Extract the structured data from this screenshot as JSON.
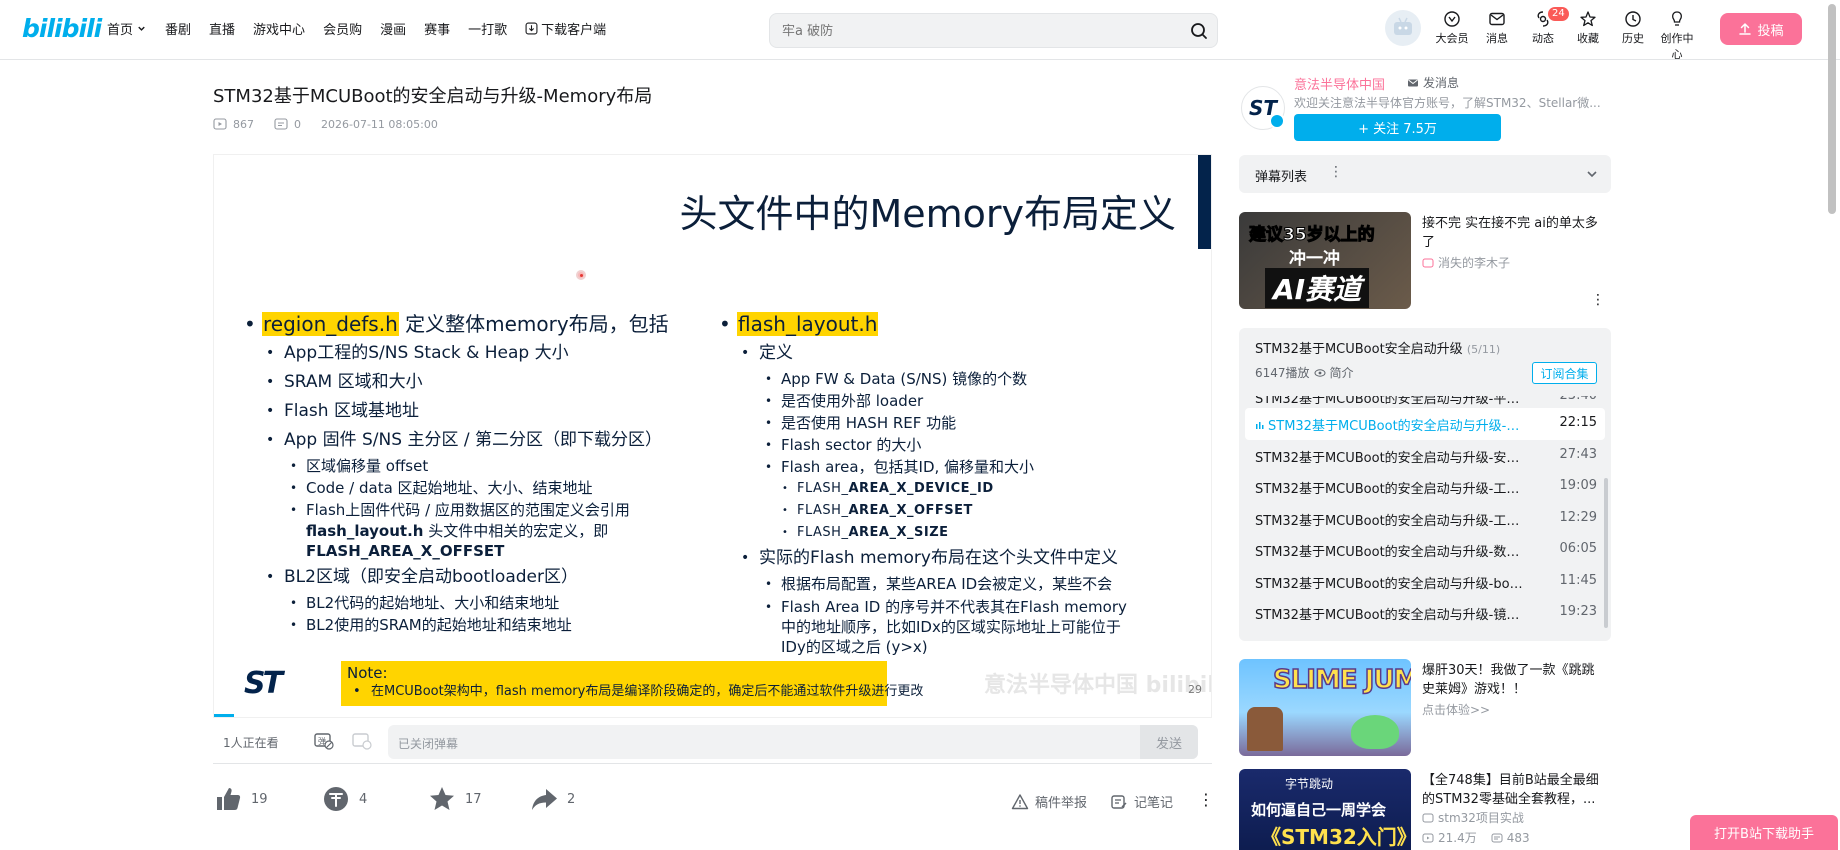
{
  "header": {
    "logo": "bilibili",
    "nav": [
      {
        "label": "首页",
        "has_chevron": true
      },
      {
        "label": "番剧"
      },
      {
        "label": "直播"
      },
      {
        "label": "游戏中心"
      },
      {
        "label": "会员购"
      },
      {
        "label": "漫画"
      },
      {
        "label": "赛事"
      },
      {
        "label": "一打歌"
      },
      {
        "label": "下载客户端",
        "icon": "download-icon"
      }
    ],
    "search_placeholder": "牢a 破防",
    "right": [
      {
        "label": "大会员",
        "icon": "vip-icon"
      },
      {
        "label": "消息",
        "icon": "message-icon"
      },
      {
        "label": "动态",
        "icon": "dynamic-icon",
        "badge": "24"
      },
      {
        "label": "收藏",
        "icon": "star-icon"
      },
      {
        "label": "历史",
        "icon": "clock-icon"
      },
      {
        "label": "创作中心",
        "icon": "bulb-icon"
      }
    ],
    "upload_label": "投稿"
  },
  "video": {
    "title": "STM32基于MCUBoot的安全启动与升级-Memory布局",
    "views": "867",
    "danmaku": "0",
    "date": "2026-07-11 08:05:00"
  },
  "slide": {
    "title": "头文件中的Memory布局定义",
    "left": {
      "head_hl": "region_defs.h",
      "head_rest": " 定义整体memory布局，包括",
      "items": [
        "App工程的S/NS Stack & Heap 大小",
        "SRAM 区域和大小",
        "Flash 区域基地址",
        "App 固件 S/NS 主分区 / 第二分区（即下载分区）"
      ],
      "sub_items": [
        "区域偏移量 offset",
        "Code / data 区起始地址、大小、结束地址",
        "Flash上固件代码 / 应用数据区的范围定义会引用"
      ],
      "sub_cont_bold": "flash_layout.h",
      "sub_cont_rest": " 头文件中相关的宏定义，即",
      "sub_cont_line2": "FLASH_AREA_X_OFFSET",
      "bl2_head": "BL2区域（即安全启动bootloader区）",
      "bl2_items": [
        "BL2代码的起始地址、大小和结束地址",
        "BL2使用的SRAM的起始地址和结束地址"
      ]
    },
    "right": {
      "head_hl": "flash_layout.h",
      "def_label": "定义",
      "def_items": [
        "App FW & Data (S/NS) 镜像的个数",
        "是否使用外部 loader",
        "是否使用 HASH REF 功能",
        "Flash sector 的大小",
        "Flash area，包括其ID, 偏移量和大小"
      ],
      "area_items": [
        {
          "pre": "FLASH_",
          "bold": "AREA_X_",
          "post": "DEVICE_ID"
        },
        {
          "pre": "FLASH_",
          "bold": "AREA_X_OFFSET",
          "post": ""
        },
        {
          "pre": "FLASH_",
          "bold": "AREA_X_SIZE",
          "post": ""
        }
      ],
      "actual_head": "实际的Flash memory布局在这个头文件中定义",
      "actual_items": [
        "根据布局配置，某些AREA ID会被定义，某些不会",
        "Flash Area ID 的序号并不代表其在Flash memory中的地址顺序，比如IDx的区域实际地址上可能位于IDy的区域之后 (y>x)"
      ]
    },
    "note_title": "Note:",
    "note_text": "在MCUBoot架构中，flash memory布局是编译阶段确定的，确定后不能通过软件升级进行更改",
    "logo": "ST",
    "watermark": "意法半导体中国 bilibili",
    "page_num": "29"
  },
  "danmu": {
    "viewers": "1人正在看",
    "placeholder": "已关闭弹幕",
    "send": "发送"
  },
  "actions": {
    "like": "19",
    "coin": "4",
    "fav": "17",
    "share": "2",
    "report": "稿件举报",
    "notes": "记笔记"
  },
  "uploader": {
    "name": "意法半导体中国",
    "msg": "发消息",
    "desc": "欢迎关注意法半导体官方账号，了解STM32、Stellar微...",
    "avatar": "ST",
    "follow": "+ 关注 7.5万"
  },
  "danmaku_list": {
    "label": "弹幕列表"
  },
  "recs": [
    {
      "title": "接不完 实在接不完 ai的单太多了",
      "author": "消失的李木子",
      "thumb_text_1": "建议35岁以上的",
      "thumb_text_2": "冲一冲",
      "thumb_text_3": "AI赛道"
    },
    {
      "title": "爆肝30天！我做了一款《跳跳史莱姆》游戏！！",
      "sub": "点击体验>>",
      "thumb_text": "SLIME JUMP"
    },
    {
      "title": "【全748集】目前B站最全最细的STM32零基础全套教程，...",
      "author": "stm32项目实战",
      "views": "21.4万",
      "danmaku": "483",
      "thumb_brand": "字节跳动",
      "thumb_text_1": "如何逼自己一周学会",
      "thumb_text_2": "《STM32入门》"
    }
  ],
  "playlist": {
    "title": "STM32基于MCUBoot安全启动升级",
    "count": "(5/11)",
    "plays": "6147播放",
    "intro": "简介",
    "subscribe": "订阅合集",
    "items": [
      {
        "title": "STM32基于MCUBoot的安全启动与升级-平台的...",
        "dur": "23:40",
        "cut": true
      },
      {
        "title": "STM32基于MCUBoot的安全启动与升级-Me...",
        "dur": "22:15",
        "active": true
      },
      {
        "title": "STM32基于MCUBoot的安全启动与升级-安全启...",
        "dur": "27:43"
      },
      {
        "title": "STM32基于MCUBoot的安全启动与升级-工程的...",
        "dur": "19:09"
      },
      {
        "title": "STM32基于MCUBoot的安全启动与升级-工程B...",
        "dur": "12:29"
      },
      {
        "title": "STM32基于MCUBoot的安全启动与升级-数据与...",
        "dur": "06:05"
      },
      {
        "title": "STM32基于MCUBoot的安全启动与升级-boot_g...",
        "dur": "11:45"
      },
      {
        "title": "STM32基于MCUBoot的安全启动与升级-镜像数...",
        "dur": "19:23"
      }
    ]
  },
  "floater": "打开B站下载助手"
}
